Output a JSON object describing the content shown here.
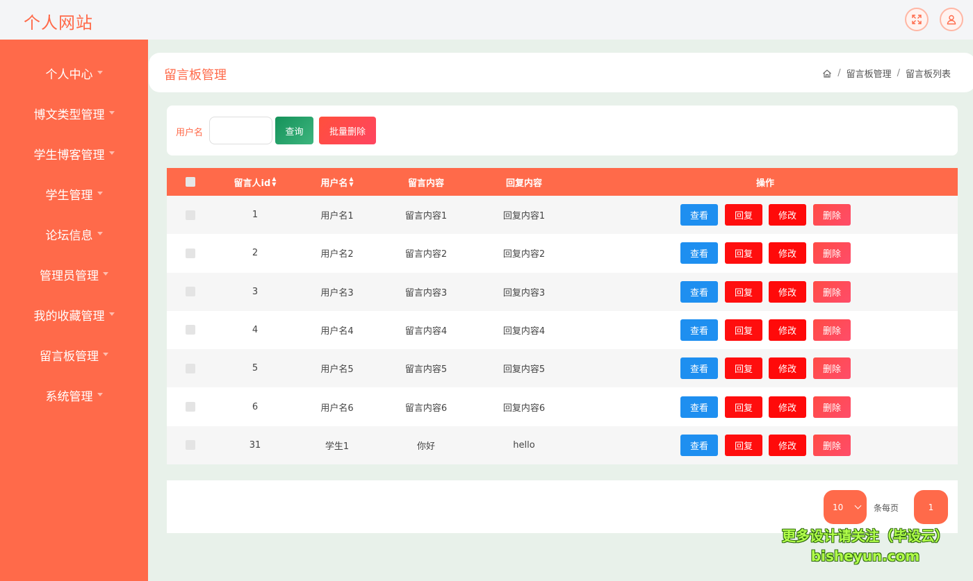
{
  "app": {
    "title": "个人网站"
  },
  "icons": {
    "fullscreen": "fullscreen-icon",
    "user": "user-icon",
    "home": "home-icon"
  },
  "colors": {
    "accent": "#ff6a4a",
    "query": "#1c9a62",
    "view": "#1e8ff0",
    "reply": "#ff0e0e",
    "delete": "#ff4b5c"
  },
  "sidebar": {
    "items": [
      {
        "label": "个人中心"
      },
      {
        "label": "博文类型管理"
      },
      {
        "label": "学生博客管理"
      },
      {
        "label": "学生管理"
      },
      {
        "label": "论坛信息"
      },
      {
        "label": "管理员管理"
      },
      {
        "label": "我的收藏管理"
      },
      {
        "label": "留言板管理"
      },
      {
        "label": "系统管理"
      }
    ]
  },
  "header": {
    "title": "留言板管理",
    "breadcrumb": [
      "留言板管理",
      "留言板列表"
    ],
    "separator": "/"
  },
  "search": {
    "label": "用户名",
    "value": "",
    "placeholder": "",
    "query_label": "查询",
    "batch_delete_label": "批量删除"
  },
  "table": {
    "columns": [
      "留言人id",
      "用户名",
      "留言内容",
      "回复内容",
      "操作"
    ],
    "actions": {
      "view": "查看",
      "reply": "回复",
      "edit": "修改",
      "delete": "删除"
    },
    "rows": [
      {
        "id": "1",
        "username": "用户名1",
        "content": "留言内容1",
        "reply": "回复内容1"
      },
      {
        "id": "2",
        "username": "用户名2",
        "content": "留言内容2",
        "reply": "回复内容2"
      },
      {
        "id": "3",
        "username": "用户名3",
        "content": "留言内容3",
        "reply": "回复内容3"
      },
      {
        "id": "4",
        "username": "用户名4",
        "content": "留言内容4",
        "reply": "回复内容4"
      },
      {
        "id": "5",
        "username": "用户名5",
        "content": "留言内容5",
        "reply": "回复内容5"
      },
      {
        "id": "6",
        "username": "用户名6",
        "content": "留言内容6",
        "reply": "回复内容6"
      },
      {
        "id": "31",
        "username": "学生1",
        "content": "你好",
        "reply": "hello"
      }
    ]
  },
  "pagination": {
    "page_size": "10",
    "per_page_label": "条每页",
    "current_page": "1"
  },
  "watermark": {
    "line1": "更多设计请关注（毕设云）",
    "line2": "bisheyun.com"
  }
}
